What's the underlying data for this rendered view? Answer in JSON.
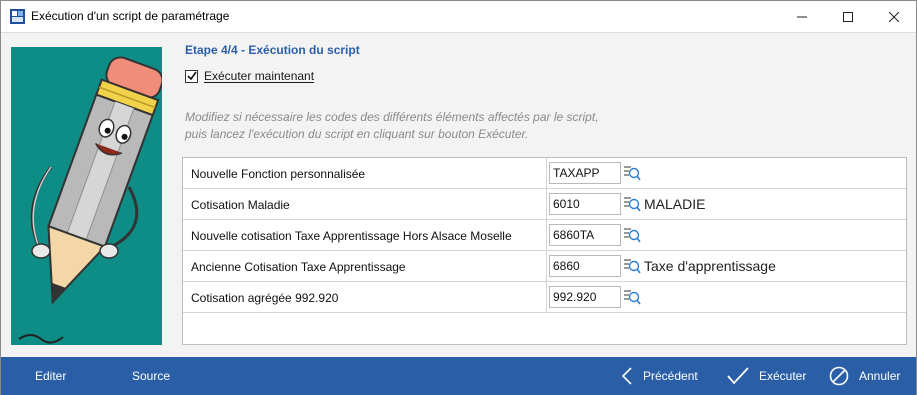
{
  "window": {
    "title": "Exécution d'un script de paramétrage"
  },
  "wizard": {
    "step_title": "Etape 4/4 - Exécution du script",
    "execute_now_label": "Exécuter maintenant",
    "execute_now_checked": true,
    "hint_line1": "Modifiez si nécessaire les codes des différents éléments affectés par le script,",
    "hint_line2": "puis lancez l'exécution du script en cliquant sur bouton Exécuter."
  },
  "rows": [
    {
      "label": "Nouvelle Fonction personnalisée",
      "code": "TAXAPP",
      "description": ""
    },
    {
      "label": "Cotisation Maladie",
      "code": "6010",
      "description": "MALADIE"
    },
    {
      "label": "Nouvelle cotisation Taxe Apprentissage Hors Alsace Moselle",
      "code": "6860TA",
      "description": ""
    },
    {
      "label": "Ancienne Cotisation Taxe Apprentissage",
      "code": "6860",
      "description": "Taxe d'apprentissage"
    },
    {
      "label": "Cotisation agrégée 992.920",
      "code": "992.920",
      "description": ""
    }
  ],
  "footer": {
    "edit_label": "Editer",
    "source_label": "Source",
    "previous_label": "Précédent",
    "execute_label": "Exécuter",
    "cancel_label": "Annuler"
  },
  "icons": {
    "app": "app-icon",
    "lookup": "search-list-icon",
    "previous": "chevron-left-icon",
    "execute": "checkmark-icon",
    "cancel": "cancel-circle-icon"
  },
  "colors": {
    "accent": "#2a5fa8",
    "illustration_bg": "#0e8c86",
    "hint_text": "#8a8a8a"
  }
}
